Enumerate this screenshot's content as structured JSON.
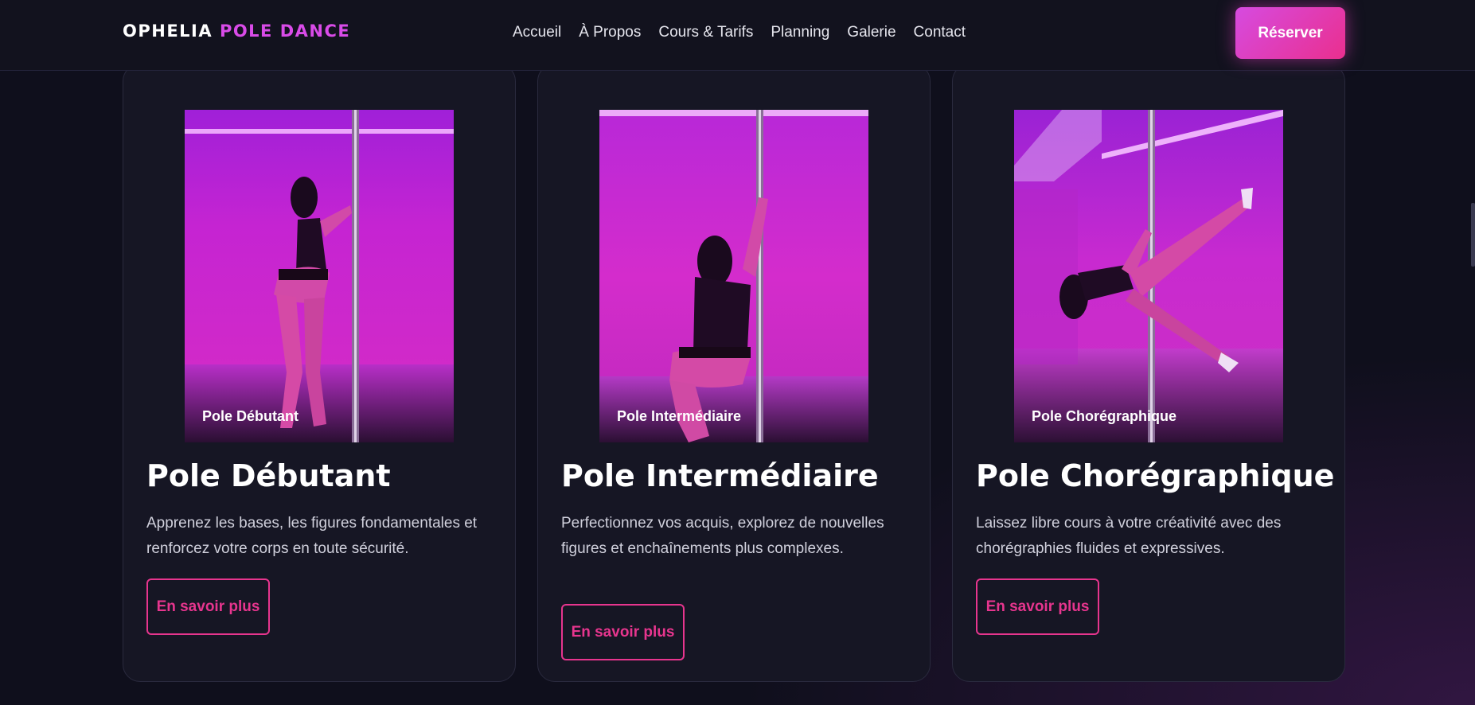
{
  "nav": {
    "logo_part1": "OPHELIA",
    "logo_part2": "POLE DANCE",
    "links": [
      "Accueil",
      "À Propos",
      "Cours & Tarifs",
      "Planning",
      "Galerie",
      "Contact"
    ],
    "cta": "Réserver"
  },
  "cards": [
    {
      "image_caption": "Pole Débutant",
      "title": "Pole Débutant",
      "description": "Apprenez les bases, les figures fondamentales et renforcez votre corps en toute sécurité.",
      "button": "En savoir plus"
    },
    {
      "image_caption": "Pole Intermédiaire",
      "title": "Pole Intermédiaire",
      "description": "Perfectionnez vos acquis, explorez de nouvelles figures et enchaînements plus complexes.",
      "button": "En savoir plus"
    },
    {
      "image_caption": "Pole Chorégraphique",
      "title": "Pole Chorégraphique",
      "description": "Laissez libre cours à votre créativité avec des chorégraphies fluides et expressives.",
      "button": "En savoir plus"
    }
  ],
  "colors": {
    "accent_purple": "#d94be8",
    "accent_pink": "#e7358e",
    "background": "#0f0f1c",
    "card_background": "#161624"
  }
}
